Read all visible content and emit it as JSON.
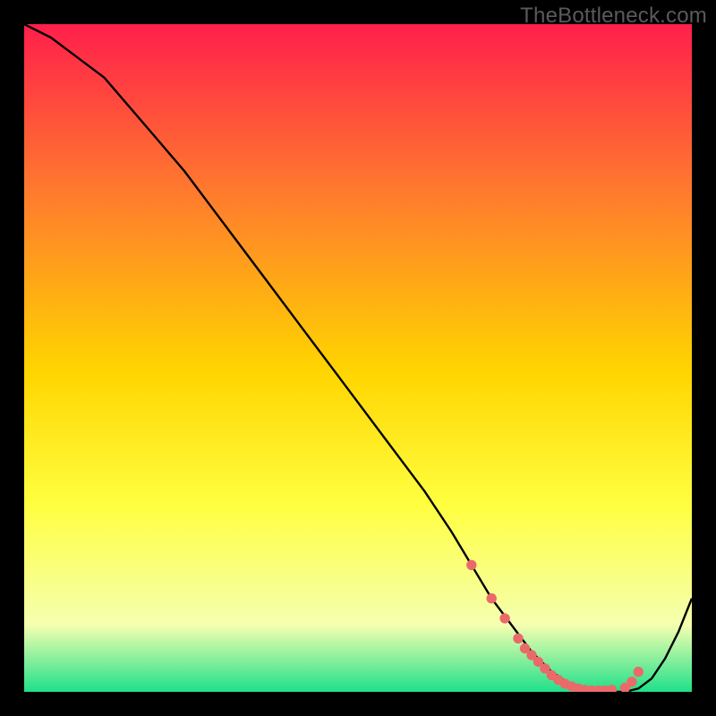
{
  "watermark": "TheBottleneck.com",
  "colors": {
    "background": "#000000",
    "gradient_top": "#ff1f4b",
    "gradient_mid1": "#ff7a2e",
    "gradient_mid2": "#ffd500",
    "gradient_mid3": "#ffff40",
    "gradient_low": "#f5ffb0",
    "gradient_bottom": "#1fe08a",
    "curve": "#000000",
    "markers": "#ea6a6a"
  },
  "chart_data": {
    "type": "line",
    "title": "",
    "xlabel": "",
    "ylabel": "",
    "xlim": [
      0,
      100
    ],
    "ylim": [
      0,
      100
    ],
    "curve": {
      "x": [
        0,
        4,
        8,
        12,
        18,
        24,
        30,
        36,
        42,
        48,
        54,
        60,
        64,
        67,
        70,
        73,
        76,
        79,
        82,
        85,
        88,
        90,
        92,
        94,
        96,
        98,
        100
      ],
      "y": [
        100,
        98,
        95,
        92,
        85,
        78,
        70,
        62,
        54,
        46,
        38,
        30,
        24,
        19,
        14,
        10,
        6,
        3,
        1,
        0,
        0,
        0,
        0.5,
        2,
        5,
        9,
        14
      ]
    },
    "markers": {
      "x": [
        67,
        70,
        72,
        74,
        75,
        76,
        77,
        78,
        79,
        80,
        81,
        82,
        83,
        84,
        85,
        86,
        87,
        88,
        90,
        91,
        92
      ],
      "y": [
        19,
        14,
        11,
        8,
        6.5,
        5.5,
        4.5,
        3.5,
        2.5,
        1.8,
        1.2,
        0.8,
        0.5,
        0.3,
        0.2,
        0.2,
        0.2,
        0.3,
        0.6,
        1.5,
        3.0
      ]
    }
  }
}
